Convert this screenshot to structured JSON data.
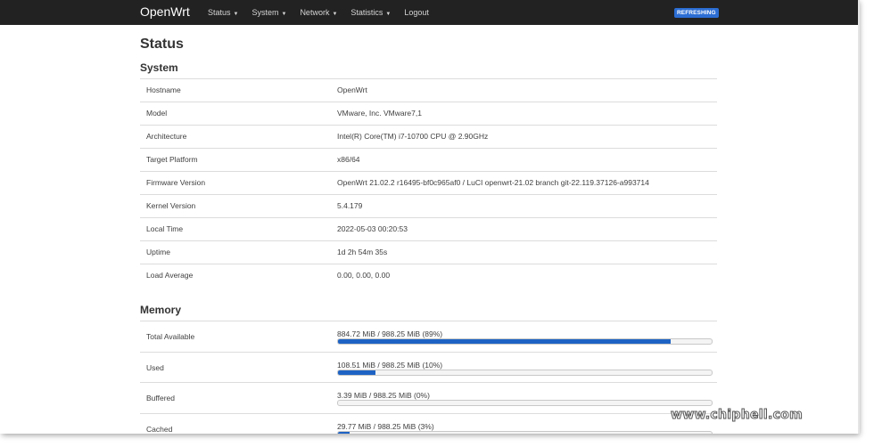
{
  "topbar": {
    "brand": "OpenWrt",
    "menu": [
      "Status",
      "System",
      "Network",
      "Statistics",
      "Logout"
    ],
    "badge": "REFRESHING"
  },
  "page_title": "Status",
  "system": {
    "heading": "System",
    "rows": [
      {
        "label": "Hostname",
        "value": "OpenWrt"
      },
      {
        "label": "Model",
        "value": "VMware, Inc. VMware7,1"
      },
      {
        "label": "Architecture",
        "value": "Intel(R) Core(TM) i7-10700 CPU @ 2.90GHz"
      },
      {
        "label": "Target Platform",
        "value": "x86/64"
      },
      {
        "label": "Firmware Version",
        "value": "OpenWrt 21.02.2 r16495-bf0c965af0 / LuCI openwrt-21.02 branch git-22.119.37126-a993714"
      },
      {
        "label": "Kernel Version",
        "value": "5.4.179"
      },
      {
        "label": "Local Time",
        "value": "2022-05-03 00:20:53"
      },
      {
        "label": "Uptime",
        "value": "1d 2h 54m 35s"
      },
      {
        "label": "Load Average",
        "value": "0.00, 0.00, 0.00"
      }
    ]
  },
  "memory": {
    "heading": "Memory",
    "rows": [
      {
        "label": "Total Available",
        "text": "884.72 MiB / 988.25 MiB (89%)",
        "percent": 89
      },
      {
        "label": "Used",
        "text": "108.51 MiB / 988.25 MiB (10%)",
        "percent": 10
      },
      {
        "label": "Buffered",
        "text": "3.39 MiB / 988.25 MiB (0%)",
        "percent": 0
      },
      {
        "label": "Cached",
        "text": "29.77 MiB / 988.25 MiB (3%)",
        "percent": 3
      }
    ]
  },
  "watermark": {
    "site": "www.chiphell.com"
  },
  "colors": {
    "topbar": "#222222",
    "accent": "#1e63c4",
    "badge": "#2b6dd3"
  }
}
